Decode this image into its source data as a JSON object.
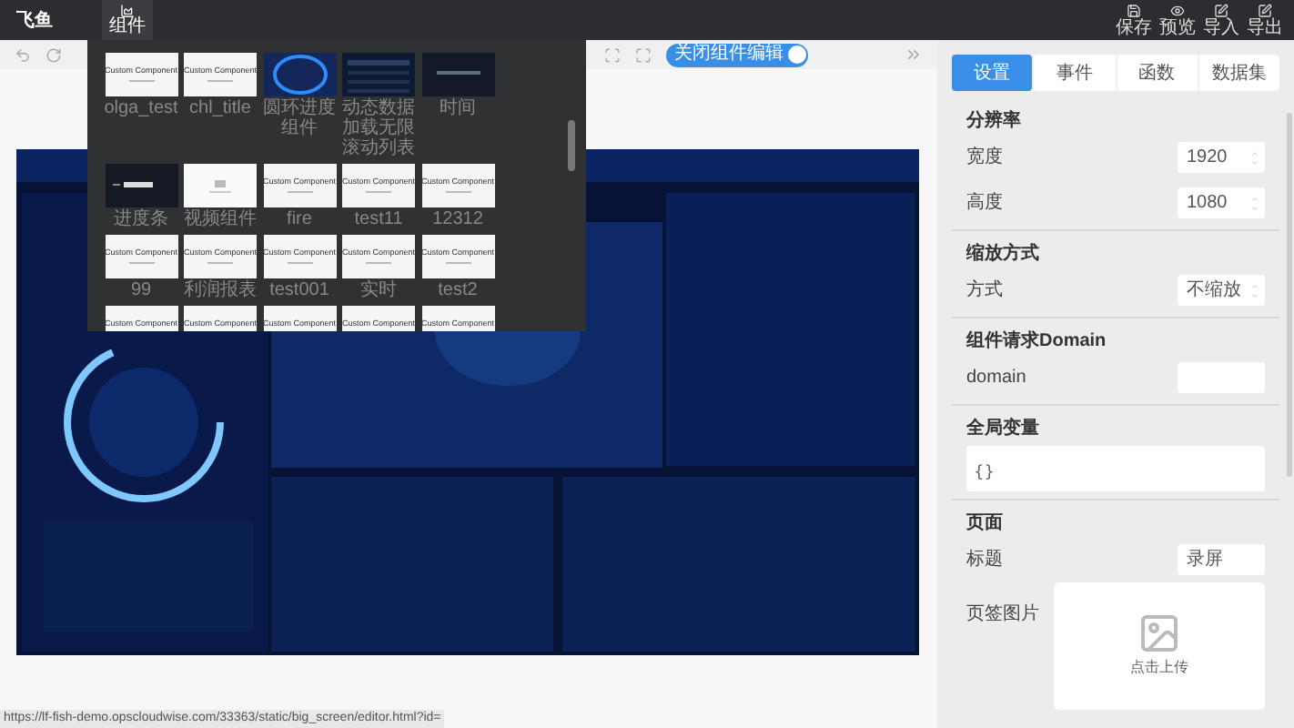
{
  "app": {
    "title": "飞鱼"
  },
  "nav_tabs": [
    {
      "label": "组件",
      "selected": true
    }
  ],
  "actions": [
    {
      "label": "保存",
      "kind": "save"
    },
    {
      "label": "预览",
      "kind": "preview"
    },
    {
      "label": "导入",
      "kind": "import"
    },
    {
      "label": "导出",
      "kind": "export"
    }
  ],
  "toolbar": {
    "toggle": {
      "label": "关闭组件编辑",
      "on": true
    }
  },
  "component_palette": {
    "items": [
      {
        "label": "olga_test",
        "kind": "custom",
        "thumb_text": "Custom Component"
      },
      {
        "label": "chl_title",
        "kind": "custom",
        "thumb_text": "Custom Component"
      },
      {
        "label": "圆环进度组件",
        "kind": "ring"
      },
      {
        "label": "动态数据加载无限滚动列表",
        "kind": "table"
      },
      {
        "label": "时间",
        "kind": "dark"
      },
      {
        "label": "进度条",
        "kind": "bar"
      },
      {
        "label": "视频组件",
        "kind": "video"
      },
      {
        "label": "fire",
        "kind": "custom",
        "thumb_text": "Custom Component"
      },
      {
        "label": "test11",
        "kind": "custom",
        "thumb_text": "Custom Component"
      },
      {
        "label": "12312",
        "kind": "custom",
        "thumb_text": "Custom Component"
      },
      {
        "label": "99",
        "kind": "custom",
        "thumb_text": "Custom Component"
      },
      {
        "label": "利润报表",
        "kind": "custom",
        "thumb_text": "Custom Component"
      },
      {
        "label": "test001",
        "kind": "custom",
        "thumb_text": "Custom Component"
      },
      {
        "label": "实时",
        "kind": "custom",
        "thumb_text": "Custom Component"
      },
      {
        "label": "test2",
        "kind": "custom",
        "thumb_text": "Custom Component"
      },
      {
        "kind": "custom",
        "thumb_text": "Custom Component"
      },
      {
        "kind": "custom",
        "thumb_text": "Custom Component"
      },
      {
        "kind": "custom",
        "thumb_text": "Custom Component"
      },
      {
        "kind": "custom",
        "thumb_text": "Custom Component"
      },
      {
        "kind": "custom",
        "thumb_text": "Custom Component"
      }
    ]
  },
  "settings_panel": {
    "tabs": [
      {
        "label": "设置",
        "selected": true
      },
      {
        "label": "事件",
        "selected": false
      },
      {
        "label": "函数",
        "selected": false
      },
      {
        "label": "数据集",
        "selected": false
      }
    ],
    "sections": [
      {
        "title": "分辨率",
        "fields": [
          {
            "kind": "number",
            "label": "宽度",
            "value": "1920"
          },
          {
            "kind": "number",
            "label": "高度",
            "value": "1080"
          }
        ]
      },
      {
        "title": "缩放方式",
        "fields": [
          {
            "kind": "select",
            "label": "方式",
            "value": "不缩放"
          }
        ]
      },
      {
        "title": "组件请求Domain",
        "fields": [
          {
            "kind": "input",
            "label": "domain"
          }
        ]
      },
      {
        "title": "全局变量",
        "fields": [
          {
            "kind": "textarea",
            "value": "{}"
          }
        ]
      },
      {
        "title": "页面",
        "fields": [
          {
            "kind": "input",
            "label": "标题",
            "value": "录屏"
          },
          {
            "kind": "upload",
            "label": "页签图片",
            "value": "点击上传"
          }
        ]
      }
    ]
  },
  "status_url": "https://lf-fish-demo.opscloudwise.com/33363/static/big_screen/editor.html?id="
}
